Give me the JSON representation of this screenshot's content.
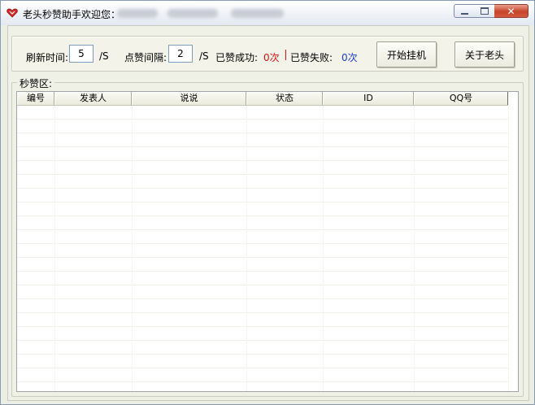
{
  "window": {
    "title": "老头秒赞助手欢迎您："
  },
  "toolbar": {
    "refresh_label": "刷新时间:",
    "refresh_value": "5",
    "refresh_unit": "/S",
    "interval_label": "点赞间隔:",
    "interval_value": "2",
    "interval_unit": "/S",
    "success_label": "已赞成功:",
    "success_value": "0次",
    "fail_label": "已赞失败:",
    "fail_value": "0次",
    "start_button": "开始挂机",
    "about_button": "关于老头"
  },
  "group": {
    "title": "秒赞区:"
  },
  "table": {
    "columns": [
      "编号",
      "发表人",
      "说说",
      "状态",
      "ID",
      "QQ号"
    ]
  },
  "colors": {
    "success": "#e01010",
    "fail": "#1a3bd6",
    "close_button": "#c7432a"
  },
  "icons": {
    "app": "heart-icon",
    "minimize": "minimize-icon",
    "maximize": "maximize-icon",
    "close": "close-icon"
  }
}
